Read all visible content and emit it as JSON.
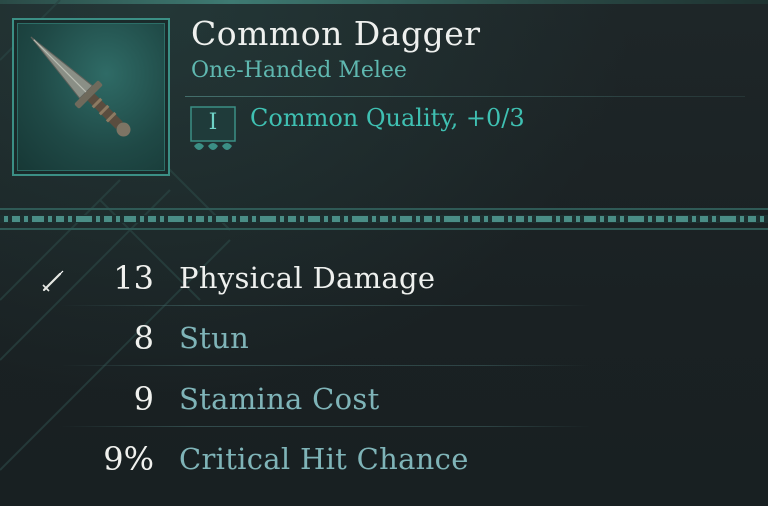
{
  "item": {
    "name": "Common Dagger",
    "type": "One-Handed Melee",
    "quality_numeral": "I",
    "quality_text": "Common Quality, +0/3",
    "icon": "dagger-icon"
  },
  "stats": [
    {
      "value": "13",
      "label": "Physical Damage",
      "style": "primary",
      "icon": "sword-icon"
    },
    {
      "value": "8",
      "label": "Stun",
      "style": "secondary"
    },
    {
      "value": "9",
      "label": "Stamina Cost",
      "style": "secondary"
    },
    {
      "value": "9%",
      "label": "Critical Hit Chance",
      "style": "secondary"
    }
  ],
  "colors": {
    "background": "#1b2224",
    "accent_teal": "#3fc0b2",
    "frame_teal": "#3b8f85",
    "title_white": "#eef0ee",
    "secondary_label": "#7fb4b8"
  }
}
